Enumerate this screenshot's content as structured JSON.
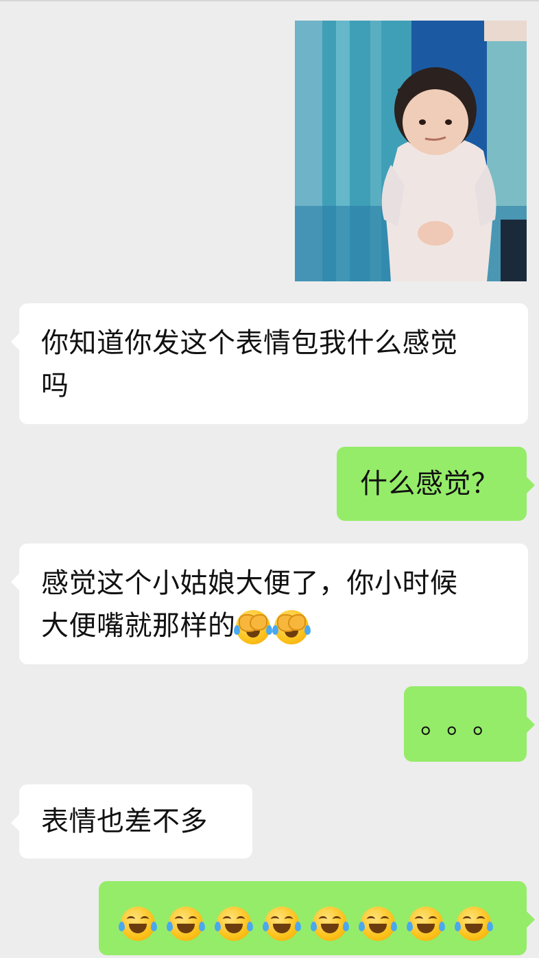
{
  "chat": {
    "messages": [
      {
        "side": "right",
        "type": "image",
        "icon": "girl-sticker-photo"
      },
      {
        "side": "left",
        "type": "text",
        "text_line1": "你知道你发这个表情包我什么感觉",
        "text_line2": "吗"
      },
      {
        "side": "right",
        "type": "text",
        "text": "什么感觉？"
      },
      {
        "side": "left",
        "type": "text",
        "text_line1": "感觉这个小姑娘大便了，你小时候",
        "text_line2": "大便嘴就那样的",
        "emoji_icons": [
          "facepalm-laugh-icon",
          "facepalm-laugh-icon"
        ]
      },
      {
        "side": "right",
        "type": "text",
        "text": "。。。"
      },
      {
        "side": "left",
        "type": "text",
        "text": "表情也差不多"
      },
      {
        "side": "right",
        "type": "emoji",
        "emoji_icons": [
          "tears-of-joy-icon",
          "tears-of-joy-icon",
          "tears-of-joy-icon",
          "tears-of-joy-icon",
          "tears-of-joy-icon",
          "tears-of-joy-icon",
          "tears-of-joy-icon",
          "tears-of-joy-icon"
        ]
      }
    ]
  },
  "colors": {
    "background": "#ededed",
    "left_bubble": "#ffffff",
    "right_bubble": "#95ec69",
    "text": "#111111"
  }
}
